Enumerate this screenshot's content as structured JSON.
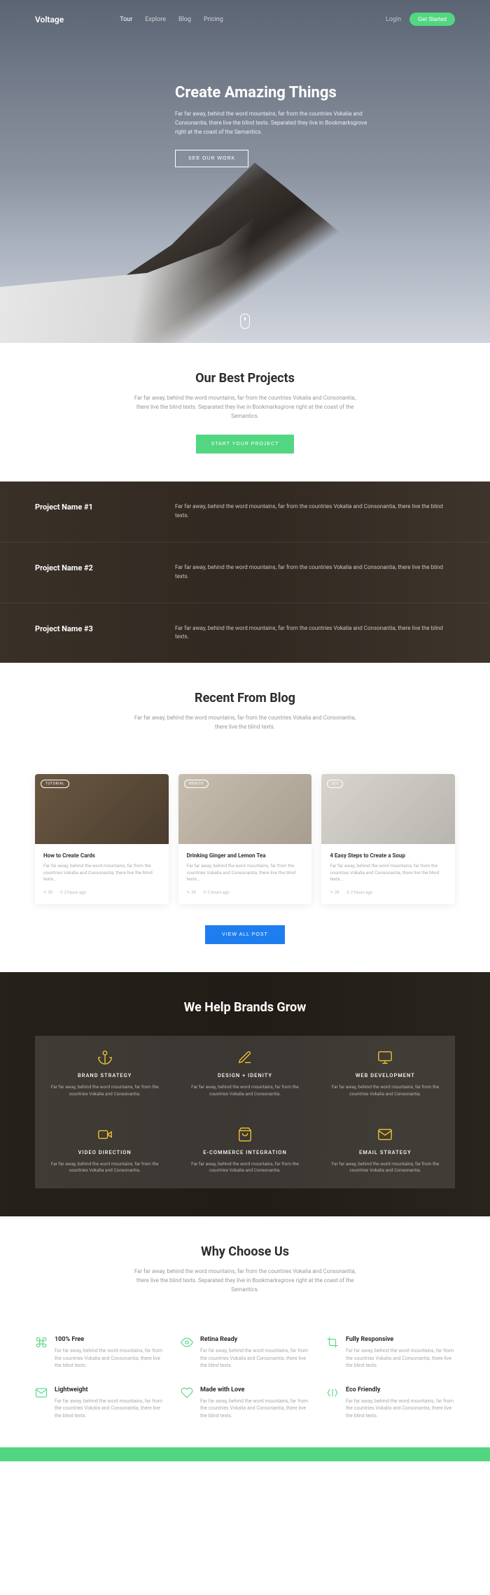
{
  "nav": {
    "logo": "Voltage",
    "links": [
      "Tour",
      "Explore",
      "Blog",
      "Pricing"
    ],
    "login": "Login",
    "cta": "Get Started"
  },
  "hero": {
    "title": "Create Amazing Things",
    "subtitle": "Far far away, behind the word mountains, far from the countries Vokalia and Consonantia, there live the blind texts. Separated they live in Bookmarksgrove right at the coast of the Semantics.",
    "button": "SEE OUR WORK"
  },
  "projects_intro": {
    "title": "Our Best Projects",
    "subtitle": "Far far away, behind the word mountains, far from the countries Vokalia and Consonantia, there live the blind texts. Separated they live in Bookmarksgrove right at the coast of the Semantics.",
    "button": "START YOUR PROJECT"
  },
  "projects": [
    {
      "name": "Project Name #1",
      "desc": "Far far away, behind the word mountains, far from the countries Vokalia and Consonantia, there live the blind texts."
    },
    {
      "name": "Project Name #2",
      "desc": "Far far away, behind the word mountains, far from the countries Vokalia and Consonantia, there live the blind texts."
    },
    {
      "name": "Project Name #3",
      "desc": "Far far away, behind the word mountains, far from the countries Vokalia and Consonantia, there live the blind texts."
    }
  ],
  "blog": {
    "title": "Recent From Blog",
    "subtitle": "Far far away, behind the word mountains, far from the countries Vokalia and Consonantia, there live the blind texts.",
    "posts": [
      {
        "tag": "TUTORIAL",
        "title": "How to Create Cards",
        "excerpt": "Far far away, behind the word mountains, far from the countries Vokalia and Consonantia, there live the blind texts...",
        "comments": "39",
        "time": "2 hours ago"
      },
      {
        "tag": "HEALTH",
        "title": "Drinking Ginger and Lemon Tea",
        "excerpt": "Far far away, behind the word mountains, far from the countries Vokalia and Consonantia, there live the blind texts...",
        "comments": "39",
        "time": "2 hours ago"
      },
      {
        "tag": "DIY",
        "title": "4 Easy Steps to Create a Soup",
        "excerpt": "Far far away, behind the word mountains, far from the countries Vokalia and Consonantia, there live the blind texts...",
        "comments": "39",
        "time": "2 hours ago"
      }
    ],
    "button": "VIEW ALL POST"
  },
  "brands": {
    "title": "We Help Brands Grow",
    "items": [
      {
        "title": "BRAND STRATEGY",
        "desc": "Far far away, behind the word mountains, far from the countries Vokalia and Consonantia."
      },
      {
        "title": "DESIGN + IDENITY",
        "desc": "Far far away, behind the word mountains, far from the countries Vokalia and Consonantia."
      },
      {
        "title": "WEB DEVELOPMENT",
        "desc": "Far far away, behind the word mountains, far from the countries Vokalia and Consonantia."
      },
      {
        "title": "VIDEO DIRECTION",
        "desc": "Far far away, behind the word mountains, far from the countries Vokalia and Consonantia."
      },
      {
        "title": "E-COMMERCE INTEGRATION",
        "desc": "Far far away, behind the word mountains, far from the countries Vokalia and Consonantia."
      },
      {
        "title": "EMAIL STRATEGY",
        "desc": "Far far away, behind the word mountains, far from the countries Vokalia and Consonantia."
      }
    ]
  },
  "choose": {
    "title": "Why Choose Us",
    "subtitle": "Far far away, behind the word mountains, far from the countries Vokalia and Consonantia, there live the blind texts. Separated they live in Bookmarksgrove right at the coast of the Semantics.",
    "items": [
      {
        "title": "100% Free",
        "desc": "Far far away, behind the word mountains, far from the countries Vokalia and Consonantia, there live the blind texts."
      },
      {
        "title": "Retina Ready",
        "desc": "Far far away, behind the word mountains, far from the countries Vokalia and Consonantia, there live the blind texts."
      },
      {
        "title": "Fully Responsive",
        "desc": "Far far away, behind the word mountains, far from the countries Vokalia and Consonantia, there live the blind texts."
      },
      {
        "title": "Lightweight",
        "desc": "Far far away, behind the word mountains, far from the countries Vokalia and Consonantia, there live the blind texts."
      },
      {
        "title": "Made with Love",
        "desc": "Far far away, behind the word mountains, far from the countries Vokalia and Consonantia, there live the blind texts."
      },
      {
        "title": "Eco Friendly",
        "desc": "Far far away, behind the word mountains, far from the countries Vokalia and Consonantia, there live the blind texts."
      }
    ]
  }
}
